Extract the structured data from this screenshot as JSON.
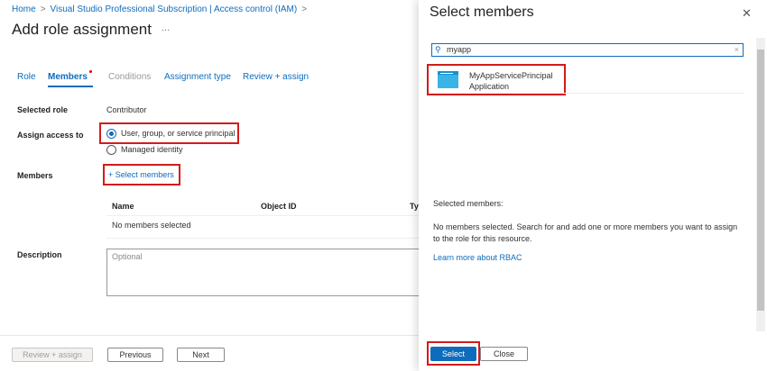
{
  "breadcrumb": [
    "Home",
    "Visual Studio Professional Subscription | Access control (IAM)"
  ],
  "page_title": "Add role assignment",
  "more_label": "...",
  "tabs": [
    {
      "label": "Role"
    },
    {
      "label": "Members"
    },
    {
      "label": "Conditions"
    },
    {
      "label": "Assignment type"
    },
    {
      "label": "Review + assign"
    }
  ],
  "form": {
    "selected_role_label": "Selected role",
    "selected_role_value": "Contributor",
    "assign_access_label": "Assign access to",
    "options": [
      "User, group, or service principal",
      "Managed identity"
    ],
    "members_label": "Members",
    "select_members_link": "+ Select members",
    "table_headers": [
      "Name",
      "Object ID",
      "Type"
    ],
    "table_empty": "No members selected",
    "description_label": "Description",
    "description_placeholder": "Optional"
  },
  "footer": {
    "review": "Review + assign",
    "previous": "Previous",
    "next": "Next"
  },
  "panel": {
    "title": "Select members",
    "search_value": "myapp",
    "results": [
      {
        "name": "MyAppServicePrincipal",
        "type": "Application"
      }
    ],
    "selected_label": "Selected members:",
    "empty_text": "No members selected. Search for and add one or more members you want to assign to the role for this resource.",
    "learn_more": "Learn more about RBAC",
    "select_button": "Select",
    "close_button": "Close"
  }
}
